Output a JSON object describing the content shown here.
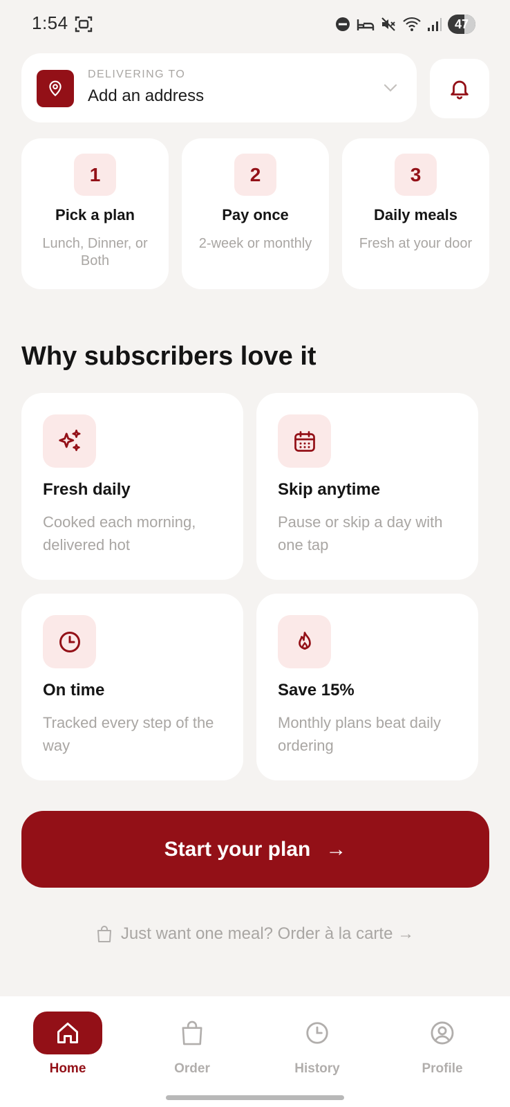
{
  "status_bar": {
    "time": "1:54",
    "battery": "47",
    "battery_level": 0.47,
    "icons": [
      "screenshot-icon",
      "dnd-icon",
      "sleep-icon",
      "mute-icon",
      "wifi-icon",
      "signal-icon",
      "battery-icon"
    ]
  },
  "header": {
    "delivering_label": "DELIVERING TO",
    "address": "Add an address"
  },
  "steps": [
    {
      "number": "1",
      "title": "Pick a plan",
      "desc": "Lunch, Dinner, or Both"
    },
    {
      "number": "2",
      "title": "Pay once",
      "desc": "2-week or monthly"
    },
    {
      "number": "3",
      "title": "Daily meals",
      "desc": "Fresh at your door"
    }
  ],
  "section_title": "Why subscribers love it",
  "features": [
    {
      "icon": "sparkles-icon",
      "title": "Fresh daily",
      "desc": "Cooked each morning, delivered hot"
    },
    {
      "icon": "calendar-icon",
      "title": "Skip anytime",
      "desc": "Pause or skip a day with one tap"
    },
    {
      "icon": "clock-icon",
      "title": "On time",
      "desc": "Tracked every step of the way"
    },
    {
      "icon": "flame-icon",
      "title": "Save 15%",
      "desc": "Monthly plans beat daily ordering"
    }
  ],
  "cta": {
    "label": "Start your plan",
    "arrow": "→"
  },
  "alacarte": {
    "label": "Just want one meal? Order à la carte →"
  },
  "nav": [
    {
      "label": "Home",
      "icon": "home-icon",
      "active": true
    },
    {
      "label": "Order",
      "icon": "bag-icon",
      "active": false
    },
    {
      "label": "History",
      "icon": "clock-icon",
      "active": false
    },
    {
      "label": "Profile",
      "icon": "profile-icon",
      "active": false
    }
  ],
  "colors": {
    "accent": "#931017",
    "accent_soft": "#fbe9e8",
    "background": "#f5f3f1",
    "muted_text": "#a9a6a3"
  }
}
